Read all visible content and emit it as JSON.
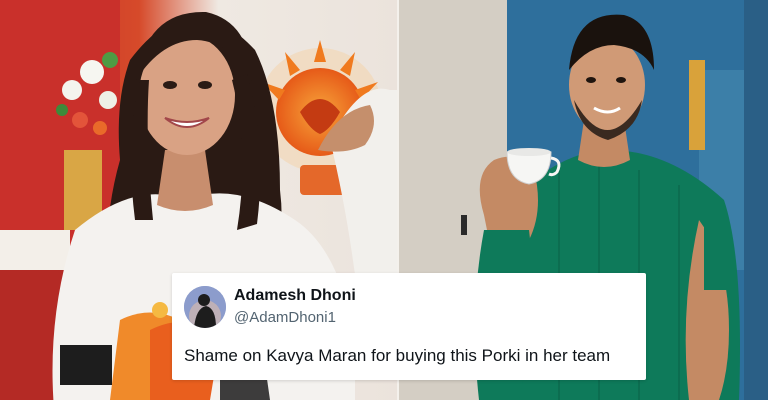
{
  "tweet": {
    "display_name": "Adamesh Dhoni",
    "handle": "@AdamDhoni1",
    "text": "Shame on Kavya Maran for buying this Porki in her team"
  },
  "photos": {
    "left": {
      "icon": "woman-smiling-photo"
    },
    "right": {
      "icon": "man-holding-teacup-photo"
    }
  },
  "colors": {
    "tweet_background": "#ffffff",
    "name_color": "#0f1419",
    "handle_color": "#536471",
    "sunrisers_orange": "#f07a1e",
    "shirt_green": "#0e7a5a"
  }
}
